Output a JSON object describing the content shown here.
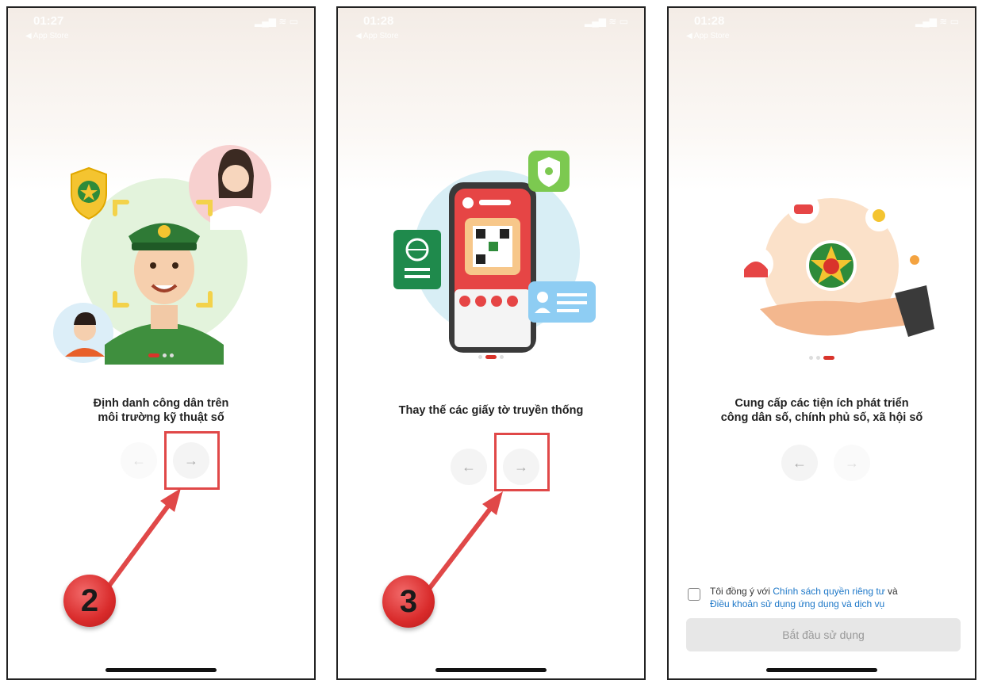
{
  "status_bar": {
    "time_1": "01:27",
    "time_2": "01:28",
    "time_3": "01:28",
    "back_label": "◀ App Store",
    "icons": "▂▄▆ ≋ ▭"
  },
  "screens": [
    {
      "caption": "Định danh công dân trên môi trường kỹ thuật số",
      "step_badge": "2"
    },
    {
      "caption": "Thay thế các giấy tờ truyền thống",
      "step_badge": "3"
    },
    {
      "caption_line1": "Cung cấp các tiện ích phát triển",
      "caption_line2": "công dân số, chính phủ số, xã hội số"
    }
  ],
  "caption_1_line1": "Định danh công dân trên",
  "caption_1_line2": "môi trường kỹ thuật số",
  "nav": {
    "prev_icon": "←",
    "next_icon": "→"
  },
  "consent": {
    "prefix": "Tôi đồng ý với ",
    "privacy_link": "Chính sách quyền riêng tư",
    "and": " và",
    "terms_link": "Điều khoản sử dụng ứng dụng và dịch vụ"
  },
  "start_button": "Bắt đầu sử dụng",
  "colors": {
    "accent_red": "#d9342b",
    "link_blue": "#1e78c8",
    "highlight": "#e04848"
  }
}
